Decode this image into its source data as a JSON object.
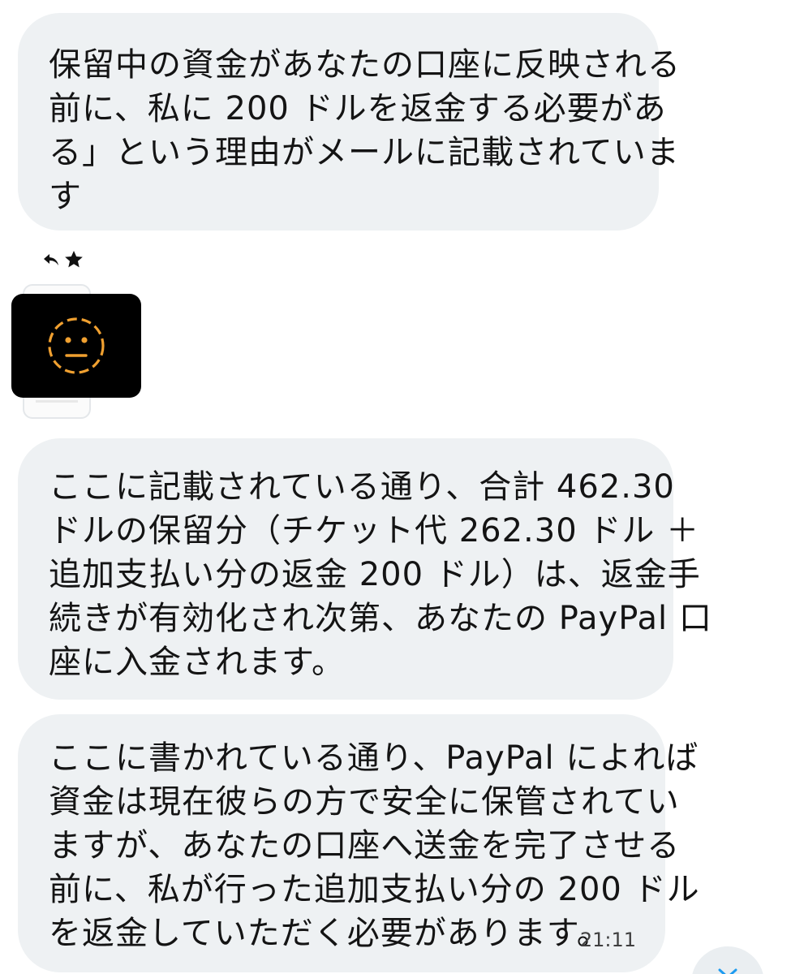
{
  "messages": [
    {
      "lines": [
        "保留中の資金があなたの口座に反映される",
        "前に、私に 200 ドルを返金する必要があ",
        "る」という理由がメールに記載されていま",
        "す"
      ]
    },
    {
      "lines": [
        "ここに記載されている通り、合計 462.30",
        "ドルの保留分（チケット代 262.30 ドル ＋",
        "追加支払い分の返金 200 ドル）は、返金手",
        "続きが有効化され次第、あなたの PayPal 口",
        "座に入金されます。"
      ]
    },
    {
      "lines": [
        "ここに書かれている通り、PayPal によれば",
        "資金は現在彼らの方で安全に保管されてい",
        "ますが、あなたの口座へ送金を完了させる",
        "前に、私が行った追加支払い分の 200 ドル",
        "を返金していただく必要があります。"
      ],
      "timestamp": "21:11"
    }
  ],
  "reactions": {
    "icons": [
      "reply-icon",
      "star-icon"
    ]
  },
  "attachment": {
    "icon": "neutral-face-icon",
    "accent_color": "#f0a030",
    "background": "#000000"
  },
  "colors": {
    "bubble": "#eef1f3",
    "text": "#141414"
  }
}
